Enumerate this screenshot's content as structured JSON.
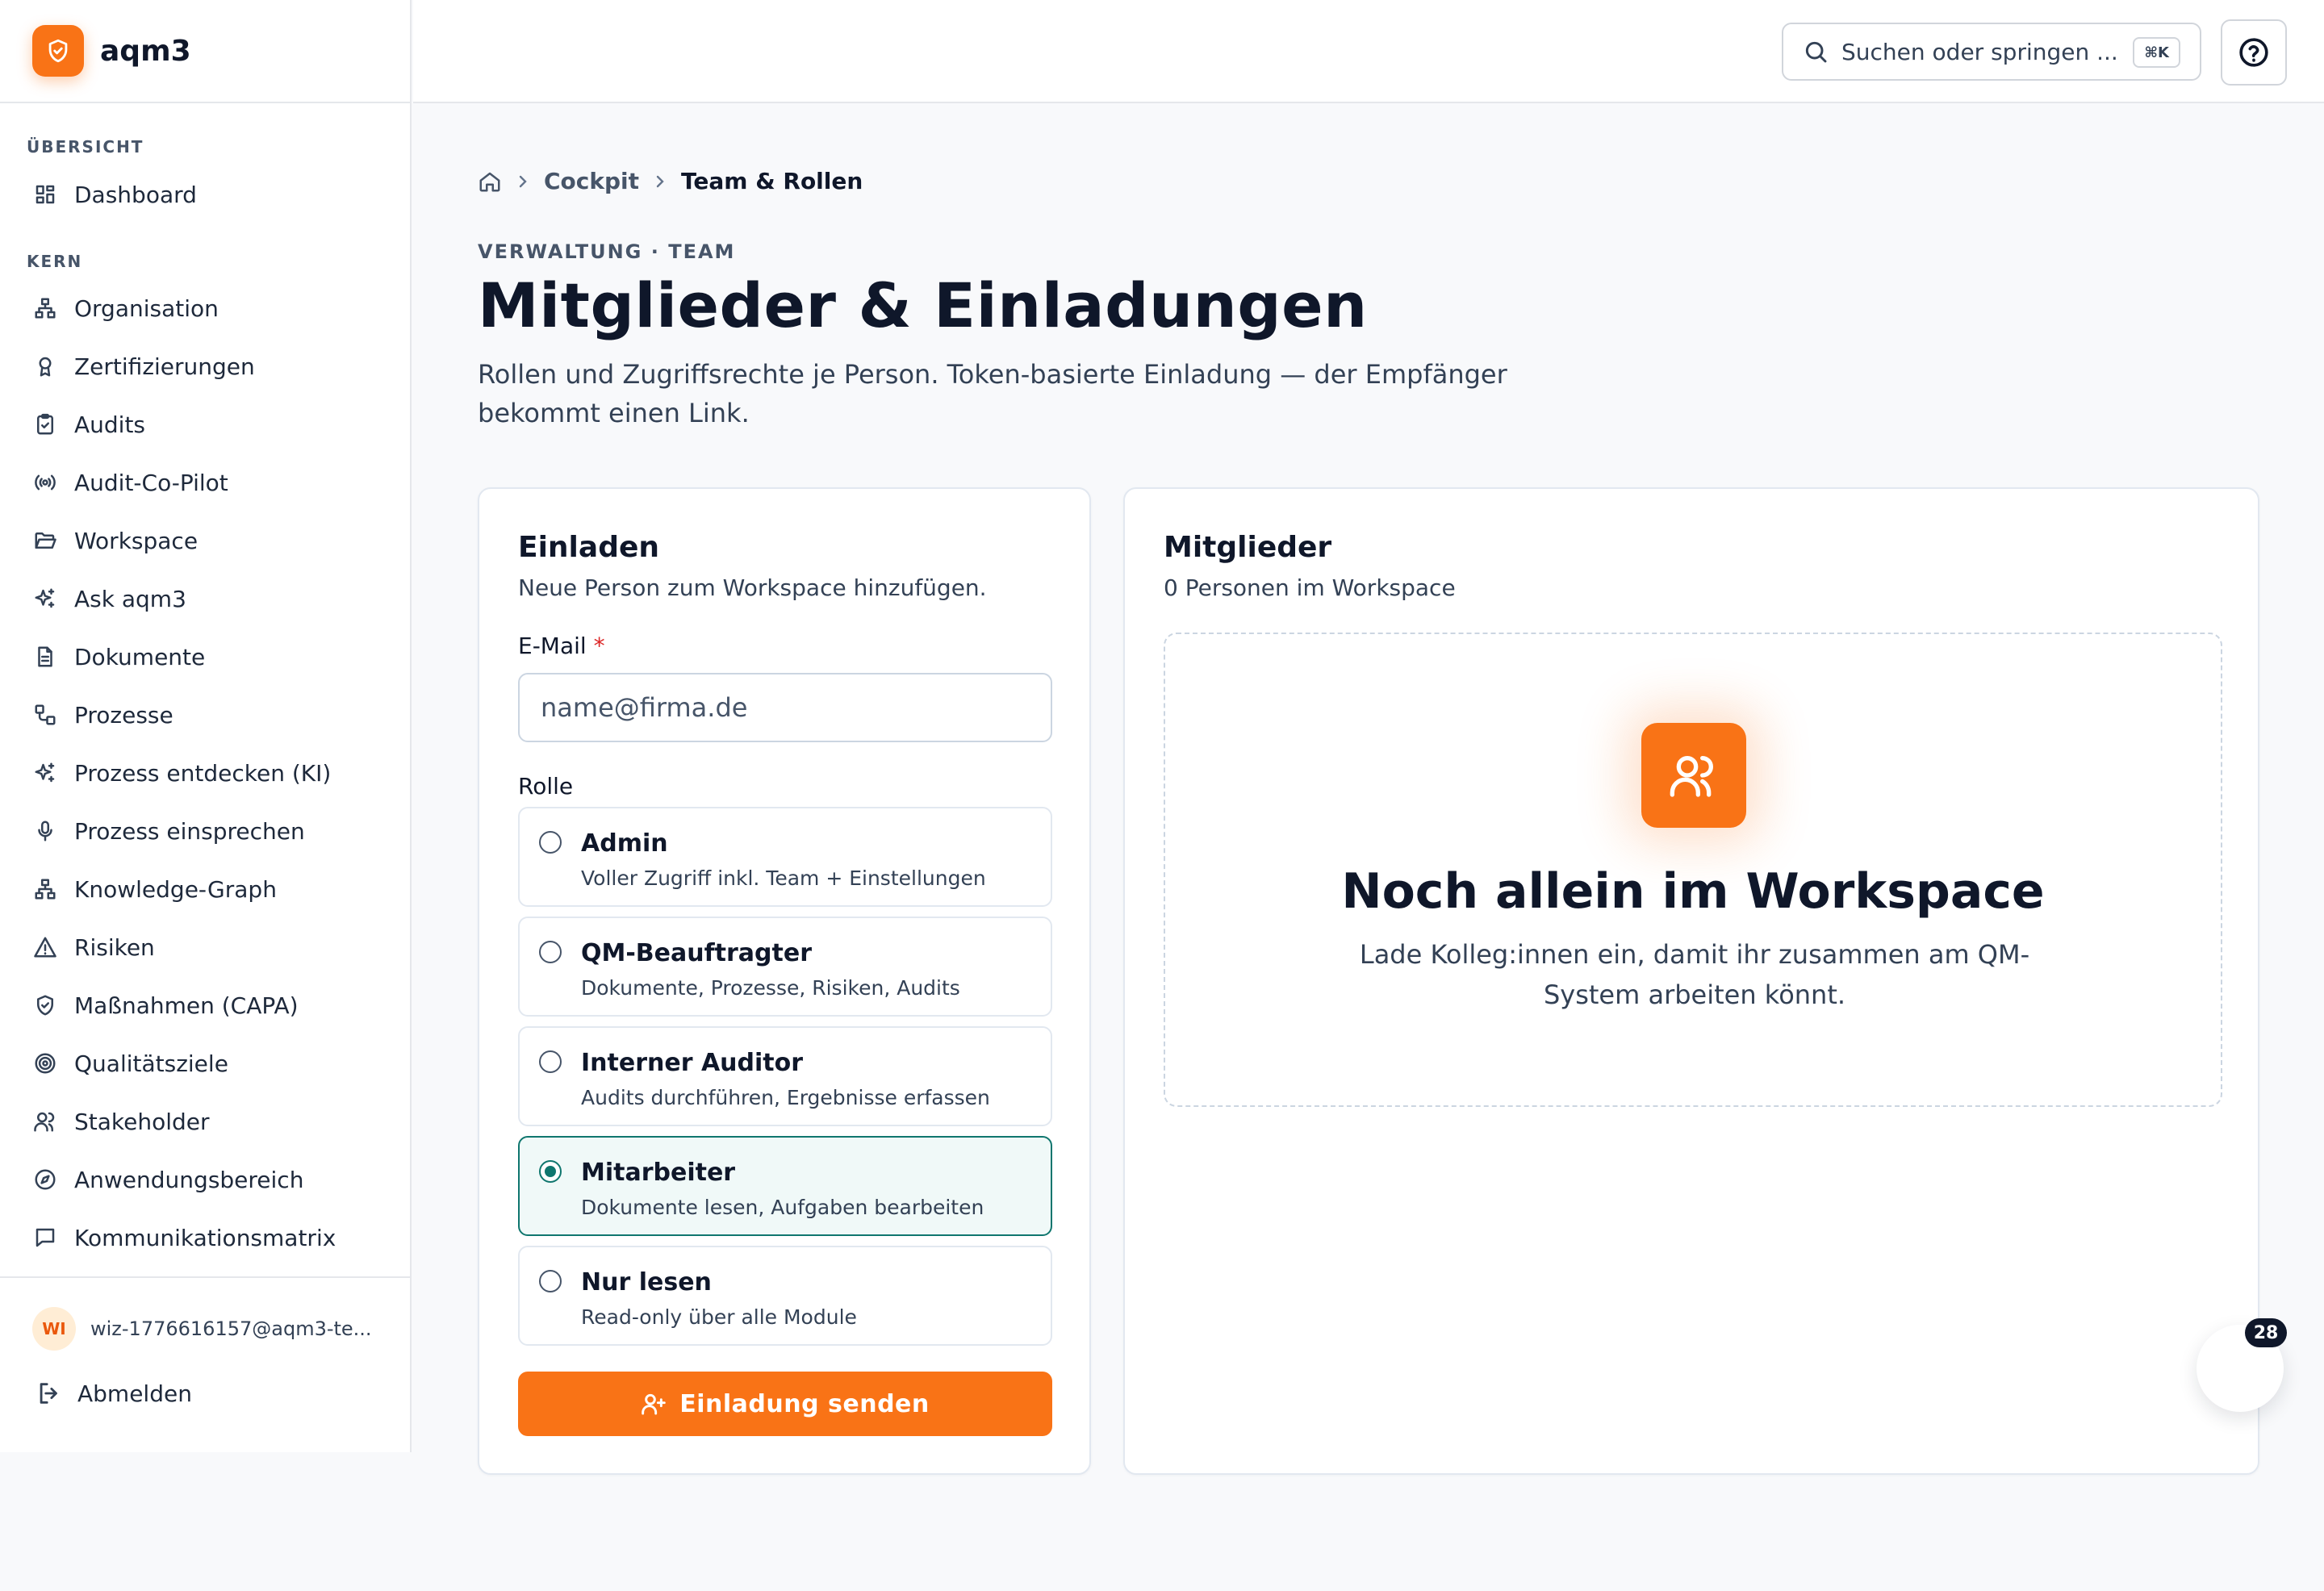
{
  "app": {
    "name": "aqm3",
    "accent_color": "#f97316",
    "brand_icon": "shield-check-icon"
  },
  "sidebar": {
    "sections": [
      {
        "label": "ÜBERSICHT"
      },
      {
        "label": "KERN"
      }
    ],
    "items": [
      {
        "label": "Dashboard",
        "icon": "grid-icon"
      },
      {
        "label": "Organisation",
        "icon": "hierarchy-icon"
      },
      {
        "label": "Zertifizierungen",
        "icon": "award-icon"
      },
      {
        "label": "Audits",
        "icon": "clipboard-check-icon"
      },
      {
        "label": "Audit-Co-Pilot",
        "icon": "broadcast-icon"
      },
      {
        "label": "Workspace",
        "icon": "folder-open-icon"
      },
      {
        "label": "Ask aqm3",
        "icon": "sparkles-icon"
      },
      {
        "label": "Dokumente",
        "icon": "document-icon"
      },
      {
        "label": "Prozesse",
        "icon": "workflow-icon"
      },
      {
        "label": "Prozess entdecken (KI)",
        "icon": "sparkles-icon"
      },
      {
        "label": "Prozess einsprechen",
        "icon": "microphone-icon"
      },
      {
        "label": "Knowledge-Graph",
        "icon": "hierarchy-icon"
      },
      {
        "label": "Risiken",
        "icon": "warning-icon"
      },
      {
        "label": "Maßnahmen (CAPA)",
        "icon": "shield-check-icon"
      },
      {
        "label": "Qualitätsziele",
        "icon": "target-icon"
      },
      {
        "label": "Stakeholder",
        "icon": "users-icon"
      },
      {
        "label": "Anwendungsbereich",
        "icon": "compass-icon"
      },
      {
        "label": "Kommunikationsmatrix",
        "icon": "message-icon"
      }
    ],
    "user": {
      "initials": "WI",
      "email": "wiz-1776616157@aqm3-te..."
    },
    "logout_label": "Abmelden"
  },
  "topbar": {
    "search_placeholder": "Suchen oder springen ...",
    "search_shortcut": "⌘K",
    "help_icon": "help-circle-icon"
  },
  "breadcrumb": {
    "items": [
      "Cockpit",
      "Team & Rollen"
    ]
  },
  "page": {
    "eyebrow": "VERWALTUNG · TEAM",
    "title": "Mitglieder & Einladungen",
    "description": "Rollen und Zugriffsrechte je Person. Token-basierte Einladung — der Empfänger bekommt einen Link."
  },
  "invite": {
    "title": "Einladen",
    "subtitle": "Neue Person zum Workspace hinzufügen.",
    "email_label": "E-Mail",
    "email_required_mark": "*",
    "email_placeholder": "name@firma.de",
    "email_value": "",
    "role_label": "Rolle",
    "roles": [
      {
        "name": "Admin",
        "desc": "Voller Zugriff inkl. Team + Einstellungen",
        "selected": false
      },
      {
        "name": "QM-Beauftragter",
        "desc": "Dokumente, Prozesse, Risiken, Audits",
        "selected": false
      },
      {
        "name": "Interner Auditor",
        "desc": "Audits durchführen, Ergebnisse erfassen",
        "selected": false
      },
      {
        "name": "Mitarbeiter",
        "desc": "Dokumente lesen, Aufgaben bearbeiten",
        "selected": true
      },
      {
        "name": "Nur lesen",
        "desc": "Read-only über alle Module",
        "selected": false
      }
    ],
    "submit_label": "Einladung senden"
  },
  "members": {
    "title": "Mitglieder",
    "subtitle": "0 Personen im Workspace",
    "empty_title": "Noch allein im Workspace",
    "empty_desc": "Lade Kolleg:innen ein, damit ihr zusammen am QM-System arbeiten könnt."
  },
  "floating": {
    "badge_count": "28"
  }
}
